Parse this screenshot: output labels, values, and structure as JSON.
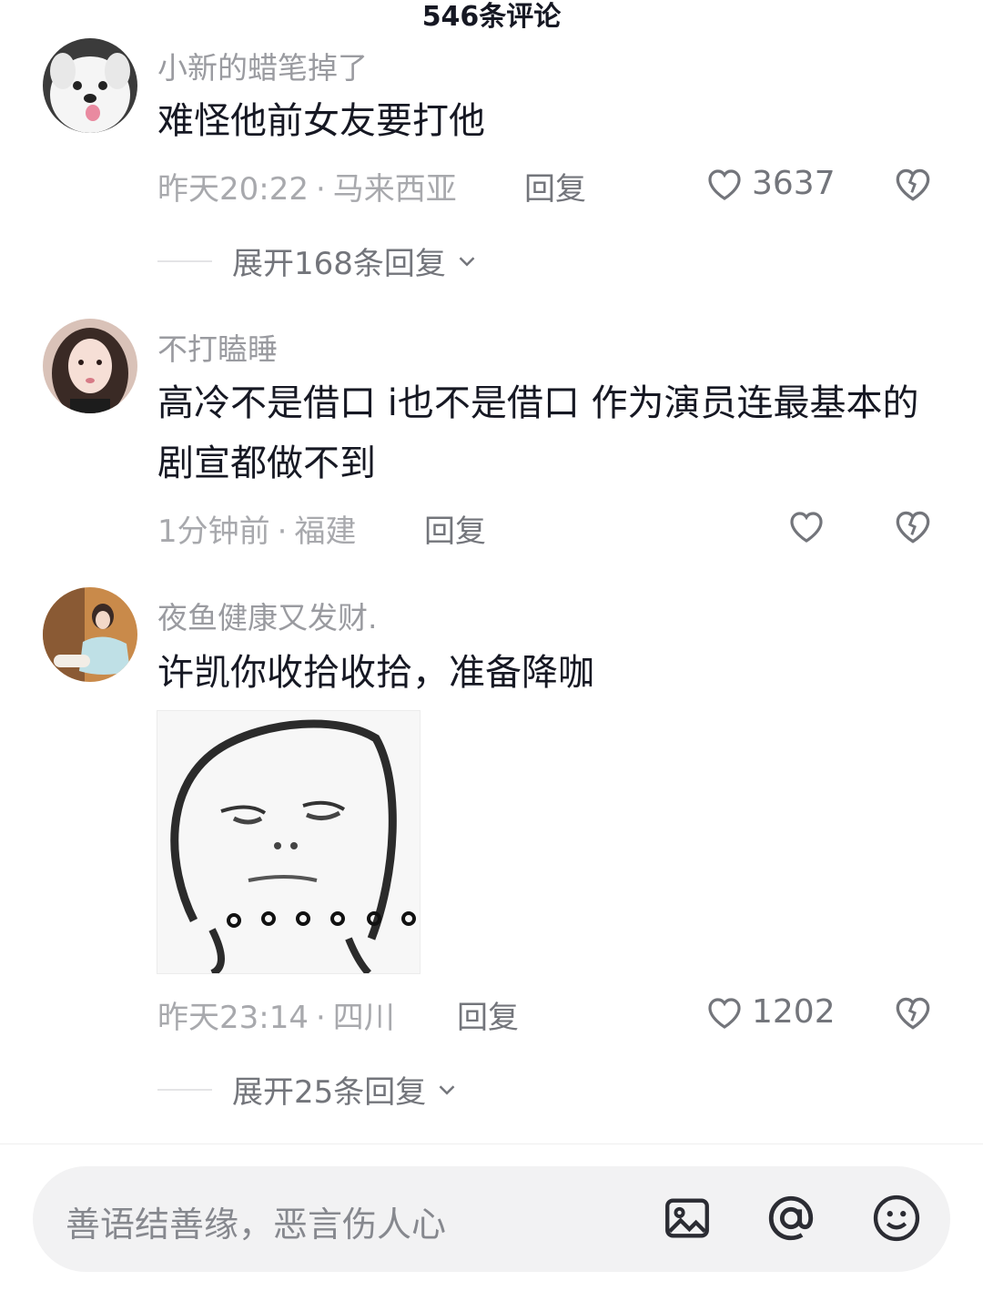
{
  "header": {
    "title": "546条评论"
  },
  "comments": [
    {
      "username": "小新的蜡笔掉了",
      "content": "难怪他前女友要打他",
      "time": "昨天20:22",
      "location": "马来西亚",
      "reply_label": "回复",
      "likes": "3637",
      "expand_label": "展开168条回复"
    },
    {
      "username": "不打瞌睡",
      "content": "高冷不是借口 i也不是借口 作为演员连最基本的剧宣都做不到",
      "time": "1分钟前",
      "location": "福建",
      "reply_label": "回复",
      "likes": ""
    },
    {
      "username": "夜鱼健康又发财.",
      "content": "许凯你收拾收拾，准备降咖",
      "time": "昨天23:14",
      "location": "四川",
      "reply_label": "回复",
      "likes": "1202",
      "expand_label": "展开25条回复"
    }
  ],
  "input": {
    "placeholder": "善语结善缘，恶言伤人心"
  },
  "colors": {
    "text_primary": "#161823",
    "text_secondary": "#9a9ba0",
    "input_bg": "#f2f2f3"
  },
  "icons": [
    "heart-icon",
    "broken-heart-icon",
    "chevron-down-icon",
    "image-icon",
    "at-icon",
    "emoji-icon"
  ]
}
